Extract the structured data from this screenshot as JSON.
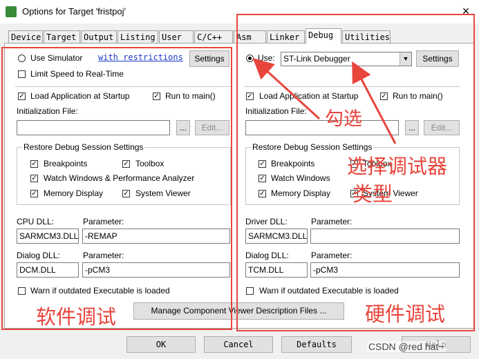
{
  "window": {
    "title": "Options for Target 'fristpoj'",
    "close_glyph": "×"
  },
  "tabs": [
    {
      "label": "Device"
    },
    {
      "label": "Target"
    },
    {
      "label": "Output"
    },
    {
      "label": "Listing"
    },
    {
      "label": "User"
    },
    {
      "label": "C/C++"
    },
    {
      "label": "Asm"
    },
    {
      "label": "Linker"
    },
    {
      "label": "Debug"
    },
    {
      "label": "Utilities"
    }
  ],
  "left": {
    "use_simulator": "Use Simulator",
    "restrictions_link": "with restrictions",
    "settings_button": "Settings",
    "limit_speed": "Limit Speed to Real-Time",
    "load_app": "Load Application at Startup",
    "run_to_main": "Run to main()",
    "init_file_label": "Initialization File:",
    "browse_button": "...",
    "edit_button": "Edit...",
    "restore_title": "Restore Debug Session Settings",
    "breakpoints": "Breakpoints",
    "toolbox": "Toolbox",
    "watch_windows": "Watch Windows & Performance Analyzer",
    "memory_display": "Memory Display",
    "system_viewer": "System Viewer",
    "cpu_dll_label": "CPU DLL:",
    "cpu_dll_value": "SARMCM3.DLL",
    "cpu_param_label": "Parameter:",
    "cpu_param_value": "-REMAP",
    "dialog_dll_label": "Dialog DLL:",
    "dialog_dll_value": "DCM.DLL",
    "dialog_param_label": "Parameter:",
    "dialog_param_value": "-pCM3",
    "warn_outdated": "Warn if outdated Executable is loaded"
  },
  "right": {
    "use_label": "Use:",
    "debugger_value": "ST-Link Debugger",
    "settings_button": "Settings",
    "load_app": "Load Application at Startup",
    "run_to_main": "Run to main()",
    "init_file_label": "Initialization File:",
    "browse_button": "...",
    "edit_button": "Edit...",
    "restore_title": "Restore Debug Session Settings",
    "breakpoints": "Breakpoints",
    "toolbox": "Toolbox",
    "watch_windows": "Watch Windows",
    "memory_display": "Memory Display",
    "system_viewer": "System Viewer",
    "driver_dll_label": "Driver DLL:",
    "driver_dll_value": "SARMCM3.DLL",
    "driver_param_label": "Parameter:",
    "driver_param_value": "",
    "dialog_dll_label": "Dialog DLL:",
    "dialog_dll_value": "TCM.DLL",
    "dialog_param_label": "Parameter:",
    "dialog_param_value": "-pCM3",
    "warn_outdated": "Warn if outdated Executable is loaded"
  },
  "manage_button": "Manage Component Viewer Description Files ...",
  "bottom_buttons": {
    "ok": "OK",
    "cancel": "Cancel",
    "defaults": "Defaults",
    "help": "Help"
  },
  "annotations": {
    "check": "勾选",
    "select_type_line1": "选择调试器",
    "select_type_line2": "类型",
    "software_debug": "软件调试",
    "hardware_debug": "硬件调试",
    "color": "#e8453c"
  },
  "watermark": "CSDN @red hat~"
}
